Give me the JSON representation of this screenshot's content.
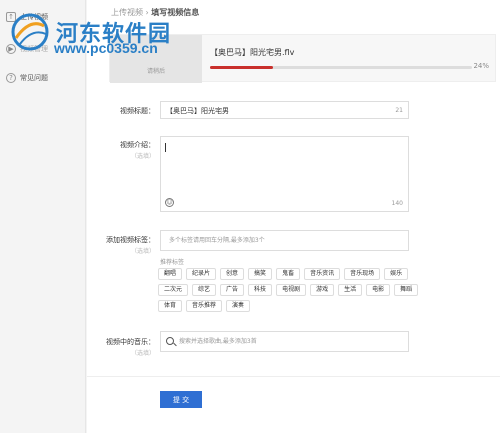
{
  "sidebar": {
    "items": [
      {
        "label": "上传视频"
      },
      {
        "label": "视频管理"
      },
      {
        "label": "常见问题"
      }
    ]
  },
  "breadcrumb": {
    "parent": "上传视频",
    "separator": " › ",
    "current": "填写视频信息"
  },
  "watermark": {
    "title": "河东软件园",
    "url": "www.pc0359.cn"
  },
  "upload": {
    "thumb_text": "请稍后",
    "file_name": "【奥巴马】阳光宅男.flv",
    "progress": 0.24,
    "progress_label": "24%"
  },
  "form": {
    "title_label": "视频标题：",
    "title_value": "【奥巴马】阳光宅男",
    "title_count": "21",
    "intro_label": "视频介绍：",
    "intro_hint": "（选填）",
    "intro_count": "140",
    "tags_label": "添加视频标签：",
    "tags_hint": "（选填）",
    "tags_placeholder": "多个标签请用回车分隔,最多添加3个",
    "recommend_title": "推荐标签",
    "tag_rows": [
      [
        "翻唱",
        "纪录片",
        "创意",
        "搞笑",
        "鬼畜",
        "音乐资讯",
        "音乐现场",
        "娱乐"
      ],
      [
        "二次元",
        "综艺",
        "广告",
        "科技",
        "电视剧",
        "游戏",
        "生活",
        "电影",
        "舞蹈"
      ],
      [
        "体育",
        "音乐推荐",
        "演奏"
      ]
    ],
    "music_label": "视频中的音乐：",
    "music_hint": "（选填）",
    "music_placeholder": "搜索并选择歌曲,最多添加3首",
    "submit_label": "提 交"
  },
  "colors": {
    "accent": "#2f6fd3",
    "progress": "#c9302c",
    "watermark": "#2a7fc6"
  }
}
